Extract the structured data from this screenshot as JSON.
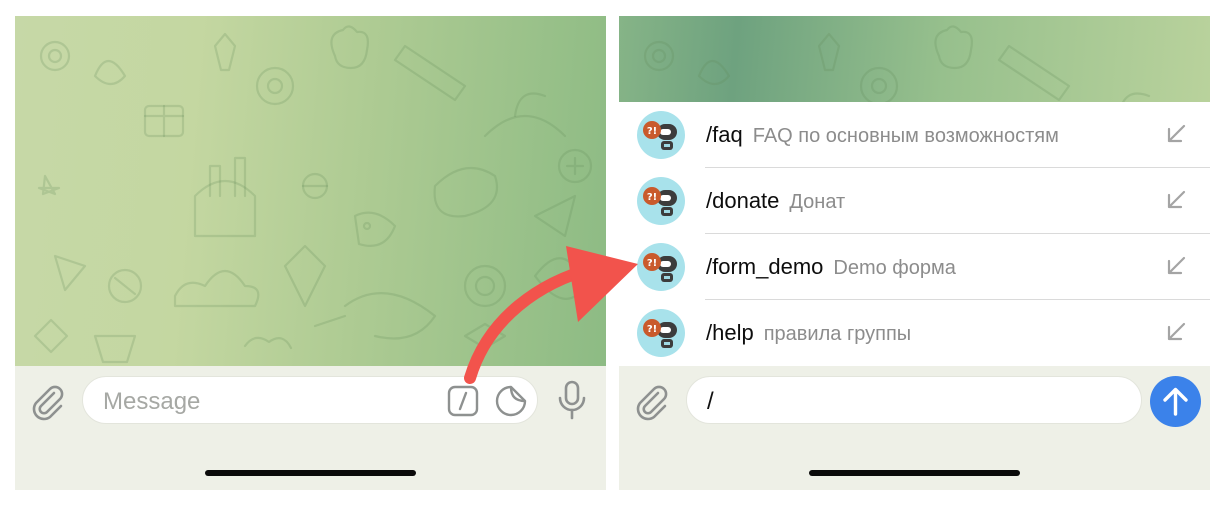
{
  "colors": {
    "accent": "#3b82ea",
    "arrow": "#f2534c",
    "avatar_bg": "#a8e2eb",
    "badge": "#c95a2c"
  },
  "left_screen": {
    "composer": {
      "placeholder": "Message",
      "icons": [
        "paperclip-icon",
        "slash-command-icon",
        "sticker-icon",
        "microphone-icon"
      ]
    }
  },
  "right_screen": {
    "commands": [
      {
        "name": "/faq",
        "description": "FAQ по основным возможностям"
      },
      {
        "name": "/donate",
        "description": "Донат"
      },
      {
        "name": "/form_demo",
        "description": "Demo форма"
      },
      {
        "name": "/help",
        "description": "правила группы"
      }
    ],
    "avatar_badge": "?!",
    "composer": {
      "value": "/",
      "icons": [
        "paperclip-icon",
        "send-arrow-icon"
      ]
    }
  }
}
